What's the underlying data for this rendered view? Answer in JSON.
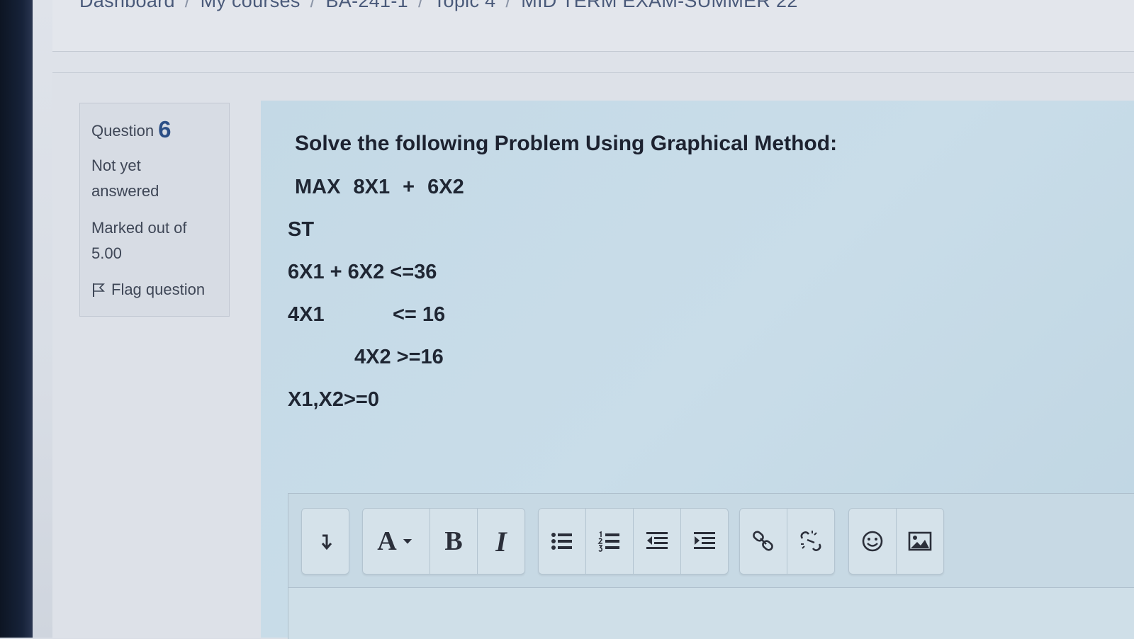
{
  "breadcrumb": [
    "Dashboard",
    "My courses",
    "BA-241-1",
    "Topic 4",
    "MID TERM EXAM-SUMMER 22"
  ],
  "question_info": {
    "label": "Question",
    "number": "6",
    "state_line1": "Not yet",
    "state_line2": "answered",
    "grade_line1": "Marked out of",
    "grade_line2": "5.00",
    "flag_label": "Flag question"
  },
  "question": {
    "title": "Solve the following Problem Using Graphical Method:",
    "objective": "MAX  8X1  +  6X2",
    "st": "ST",
    "constraint1": "6X1 + 6X2 <=36",
    "constraint2_lhs": "4X1",
    "constraint2_rhs": "<= 16",
    "constraint3": "4X2 >=16",
    "nonnegativity": "X1,X2>=0"
  },
  "toolbar": {
    "groups": [
      [
        "toggle-toolbar"
      ],
      [
        "font",
        "bold",
        "italic"
      ],
      [
        "bulleted-list",
        "numbered-list",
        "outdent",
        "indent"
      ],
      [
        "link",
        "unlink"
      ],
      [
        "emoji",
        "image"
      ]
    ],
    "font_label": "A",
    "bold_label": "B",
    "italic_label": "I"
  }
}
